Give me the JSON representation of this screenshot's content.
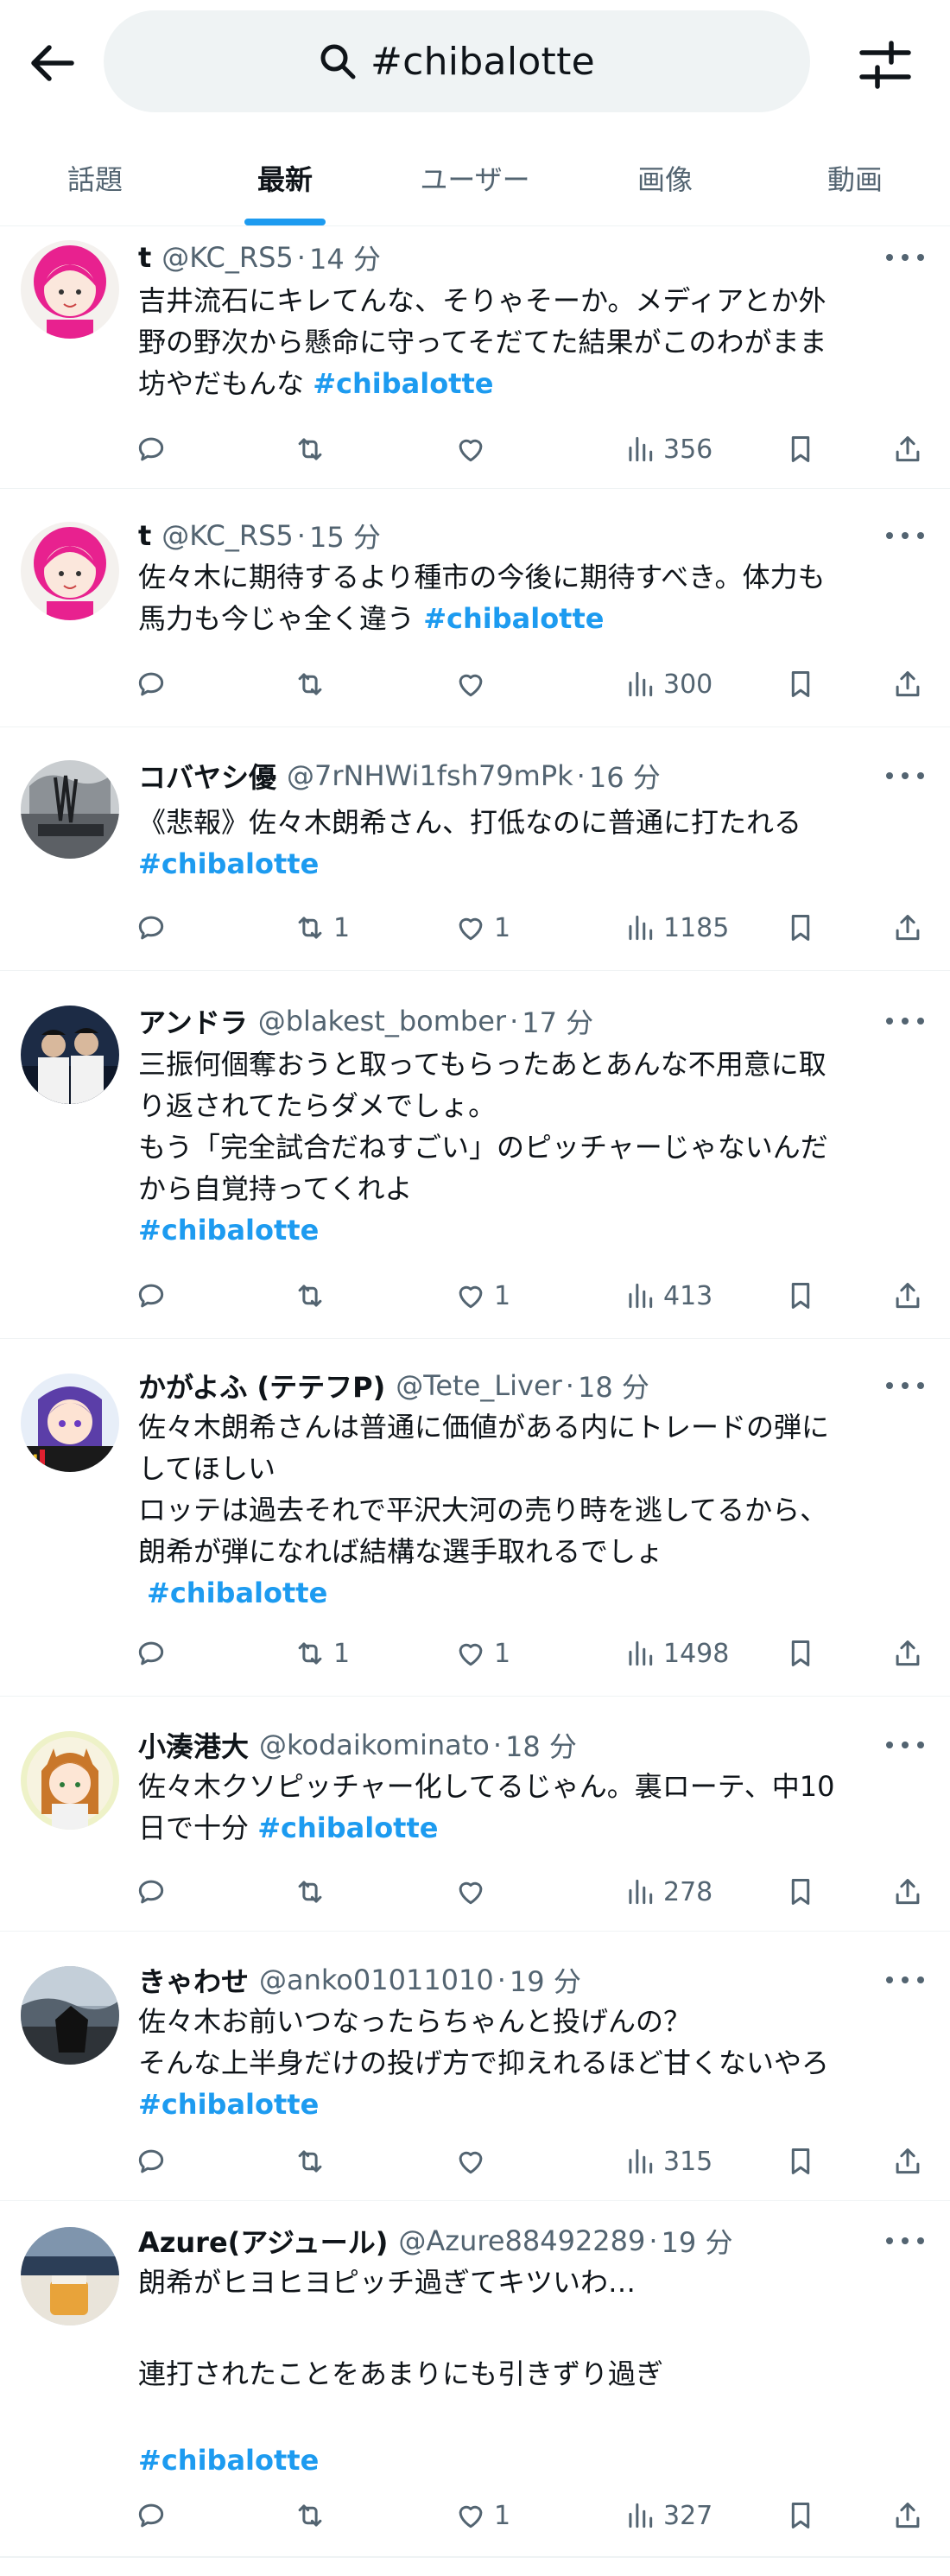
{
  "header": {
    "back_icon": "arrow-left-icon",
    "search_query": "#chibalotte",
    "search_icon": "search-icon",
    "filter_icon": "sliders-icon"
  },
  "tabs": [
    {
      "label": "話題",
      "active": false
    },
    {
      "label": "最新",
      "active": true
    },
    {
      "label": "ユーザー",
      "active": false
    },
    {
      "label": "画像",
      "active": false
    },
    {
      "label": "動画",
      "active": false
    }
  ],
  "colors": {
    "accent": "#1d9bf0",
    "text": "#0f1419",
    "muted": "#536471",
    "search_bg": "#eff3f4"
  },
  "tweets": [
    {
      "name": "t",
      "handle": "@KC_RS5",
      "dot": "·",
      "time": "14 分",
      "lines": [
        "吉井流石にキレてんな、そりゃそーか。メディアとか外",
        "野の野次から懸命に守ってそだてた結果がこのわがまま",
        "坊やだもんな "
      ],
      "hashtag": "#chibalotte",
      "retweets": "",
      "likes": "",
      "views": "356"
    },
    {
      "name": "t",
      "handle": "@KC_RS5",
      "dot": "·",
      "time": "15 分",
      "lines": [
        "佐々木に期待するより種市の今後に期待すべき。体力も",
        "馬力も今じゃ全く違う "
      ],
      "hashtag": "#chibalotte",
      "retweets": "",
      "likes": "",
      "views": "300"
    },
    {
      "name": "コバヤシ優",
      "handle": "@7rNHWi1fsh79mPk",
      "dot": "·",
      "time": "16 分",
      "lines": [
        "《悲報》佐々木朗希さん、打低なのに普通に打たれる"
      ],
      "hashtag": "#chibalotte",
      "retweets": "1",
      "likes": "1",
      "views": "1185"
    },
    {
      "name": "アンドラ",
      "handle": "@blakest_bomber",
      "dot": "·",
      "time": "17 分",
      "lines": [
        "三振何個奪おうと取ってもらったあとあんな不用意に取",
        "り返されてたらダメでしょ。",
        "もう「完全試合だねすごい」のピッチャーじゃないんだ",
        "から自覚持ってくれよ"
      ],
      "hashtag": "#chibalotte",
      "retweets": "",
      "likes": "1",
      "views": "413"
    },
    {
      "name": "かがよふ (テテフP)",
      "handle": "@Tete_Liver",
      "dot": "·",
      "time": "18 分",
      "lines": [
        "佐々木朗希さんは普通に価値がある内にトレードの弾に",
        "してほしい",
        "ロッテは過去それで平沢大河の売り時を逃してるから、",
        "朗希が弾になれば結構な選手取れるでしょ"
      ],
      "hashtag": "#chibalotte",
      "retweets": "1",
      "likes": "1",
      "views": "1498"
    },
    {
      "name": "小湊港大",
      "handle": "@kodaikominato",
      "dot": "·",
      "time": "18 分",
      "lines": [
        "佐々木クソピッチャー化してるじゃん。裏ローテ、中10",
        "日で十分 "
      ],
      "hashtag": "#chibalotte",
      "retweets": "",
      "likes": "",
      "views": "278"
    },
    {
      "name": "きゃわせ",
      "handle": "@anko01011010",
      "dot": "·",
      "time": "19 分",
      "lines": [
        "佐々木お前いつなったらちゃんと投げんの？",
        "そんな上半身だけの投げ方で抑えれるほど甘くないやろ"
      ],
      "hashtag": "#chibalotte",
      "retweets": "",
      "likes": "",
      "views": "315"
    },
    {
      "name": "Azure(アジュール)",
      "handle": "@Azure88492289",
      "dot": "·",
      "time": "19 分",
      "lines": [
        "朗希がヒヨヒヨピッチ過ぎてキツいわ…",
        "",
        "連打されたことをあまりにも引きずり過ぎ",
        ""
      ],
      "hashtag": "#chibalotte",
      "retweets": "",
      "likes": "1",
      "views": "327"
    }
  ]
}
